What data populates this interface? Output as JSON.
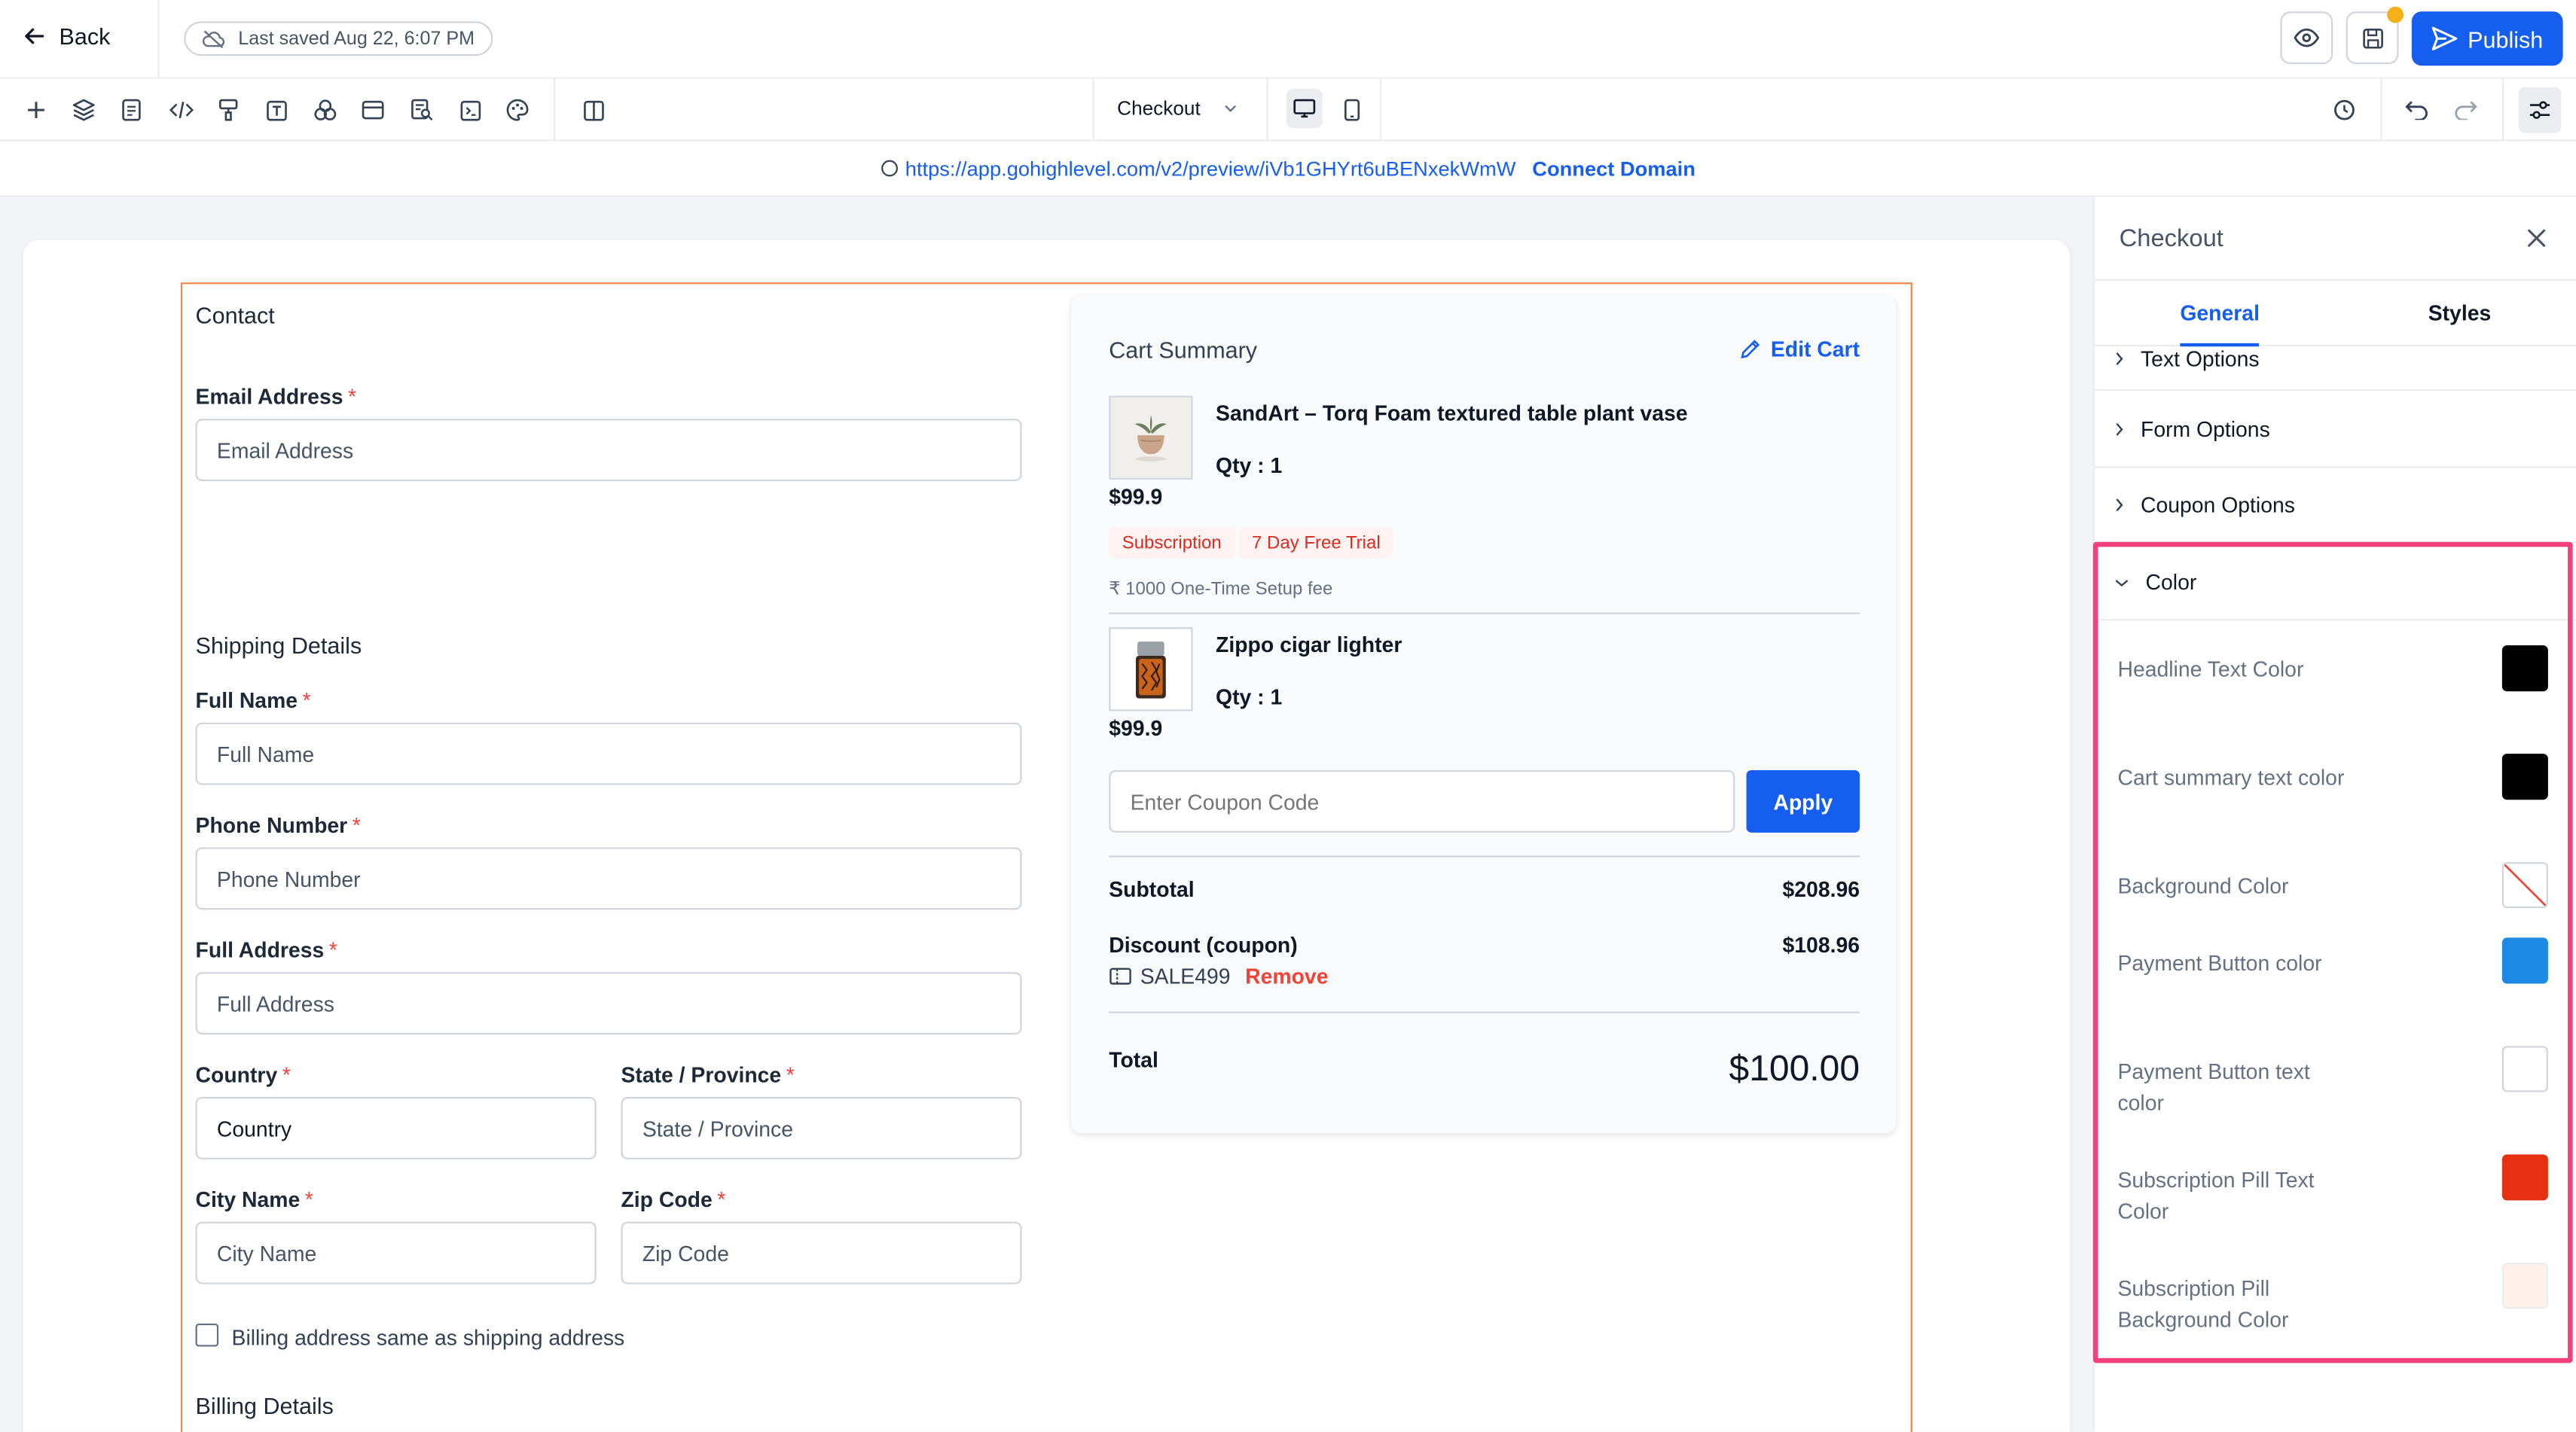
{
  "topbar": {
    "back_label": "Back",
    "last_saved": "Last saved Aug 22, 6:07 PM",
    "publish_label": "Publish"
  },
  "toolbar": {
    "page_name": "Checkout",
    "tools": [
      "plus-icon",
      "layers-icon",
      "page-icon",
      "code-icon",
      "paint-icon",
      "text-icon",
      "shapes-icon",
      "card-icon",
      "search-doc-icon",
      "terminal-icon",
      "palette-icon",
      "columns-icon"
    ]
  },
  "urlbar": {
    "url": "https://app.gohighlevel.com/v2/preview/iVb1GHYrt6uBENxekWmW",
    "connect_label": "Connect Domain"
  },
  "form": {
    "contact_title": "Contact",
    "email_label": "Email Address",
    "email_placeholder": "Email Address",
    "shipping_title": "Shipping Details",
    "full_name_label": "Full Name",
    "full_name_placeholder": "Full Name",
    "phone_label": "Phone Number",
    "phone_placeholder": "Phone Number",
    "address_label": "Full Address",
    "address_placeholder": "Full Address",
    "country_label": "Country",
    "country_value": "Country",
    "state_label": "State / Province",
    "state_placeholder": "State / Province",
    "city_label": "City Name",
    "city_placeholder": "City Name",
    "zip_label": "Zip Code",
    "zip_placeholder": "Zip Code",
    "billing_same_label": "Billing address same as shipping address",
    "billing_title": "Billing Details"
  },
  "cart": {
    "title": "Cart Summary",
    "edit_label": "Edit Cart",
    "items": [
      {
        "name": "SandArt – Torq Foam textured table plant vase",
        "qty": "Qty : 1",
        "price": "$99.9"
      },
      {
        "name": "Zippo cigar lighter",
        "qty": "Qty : 1",
        "price": "$99.9"
      }
    ],
    "pill_subscription": "Subscription",
    "pill_trial": "7 Day Free Trial",
    "setup_fee": "₹ 1000 One-Time Setup fee",
    "coupon_placeholder": "Enter Coupon Code",
    "apply_label": "Apply",
    "subtotal_label": "Subtotal",
    "subtotal_value": "$208.96",
    "discount_label": "Discount (coupon)",
    "discount_value": "$108.96",
    "coupon_code": "SALE499",
    "remove_label": "Remove",
    "total_label": "Total",
    "total_value": "$100.00"
  },
  "panel": {
    "title": "Checkout",
    "tab_general": "General",
    "tab_styles": "Styles",
    "sections": [
      "Text Options",
      "Form Options",
      "Coupon Options",
      "Color"
    ],
    "colors": [
      {
        "label": "Headline Text Color",
        "hex": "#000000"
      },
      {
        "label": "Cart summary text color",
        "hex": "#000000"
      },
      {
        "label": "Background Color",
        "hex": "transparent"
      },
      {
        "label": "Payment Button color",
        "hex": "#1e88e5"
      },
      {
        "label": "Payment Button text color",
        "hex": "#ffffff"
      },
      {
        "label": "Subscription Pill Text Color",
        "hex": "#e53012"
      },
      {
        "label": "Subscription Pill Background Color",
        "hex": "#fef3ec"
      }
    ]
  }
}
